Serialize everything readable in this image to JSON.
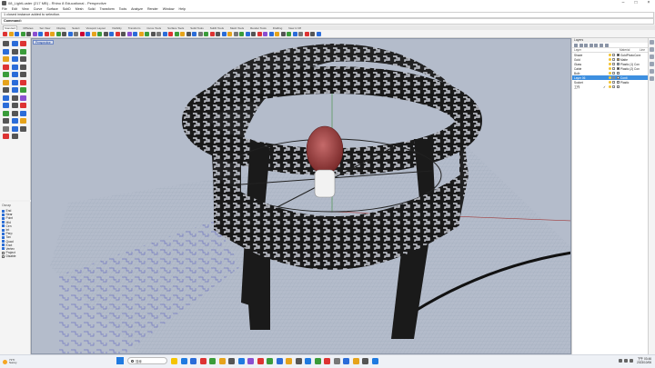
{
  "window": {
    "title": "08_LightLuster (217 MB) - Rhino 8 Educational - Perspective"
  },
  "menu": [
    "File",
    "Edit",
    "View",
    "Curve",
    "Surface",
    "SubD",
    "Mesh",
    "Solid",
    "Transform",
    "Tools",
    "Analyze",
    "Render",
    "Window",
    "Help"
  ],
  "command": {
    "history": "1 closed instance added to selection.",
    "prompt": "Command:"
  },
  "tabs": [
    "Standard",
    "CPlanes",
    "Set View",
    "Display",
    "Select",
    "Viewport Layout",
    "Visibility",
    "Transform",
    "Curve Tools",
    "Surface Tools",
    "Solid Tools",
    "SubD Tools",
    "Mesh Tools",
    "Render Tools",
    "Drafting",
    "New in V8"
  ],
  "toolbar_colors": [
    "#d33",
    "#e6a31b",
    "#2b6cd8",
    "#3a9c3a",
    "#555",
    "#8a4fd0",
    "#2b6cd8",
    "#d33",
    "#e6a31b",
    "#3a9c3a",
    "#555",
    "#2b6cd8",
    "#777",
    "#c03",
    "#2b6cd8",
    "#e6a31b",
    "#3a9c3a",
    "#555",
    "#2b6cd8",
    "#d33",
    "#555",
    "#8a4fd0",
    "#2b6cd8",
    "#e6a31b",
    "#3a9c3a",
    "#555",
    "#777",
    "#2b6cd8",
    "#d33",
    "#3a9c3a",
    "#e6a31b",
    "#555",
    "#2b6cd8",
    "#777",
    "#3a9c3a",
    "#d33",
    "#555",
    "#2b6cd8",
    "#e6a31b",
    "#777",
    "#3a9c3a",
    "#2b6cd8",
    "#555",
    "#d33",
    "#8a4fd0",
    "#2b6cd8",
    "#e6a31b",
    "#555",
    "#3a9c3a",
    "#2b6cd8",
    "#777",
    "#d33",
    "#555",
    "#2b6cd8"
  ],
  "left_tool_colors": [
    "#555",
    "#2b6cd8",
    "#d33",
    "#2b6cd8",
    "#555",
    "#3a9c3a",
    "#e6a31b",
    "#2b6cd8",
    "#555",
    "#d33",
    "#2b6cd8",
    "#555",
    "#3a9c3a",
    "#2b6cd8",
    "#555",
    "#e6a31b",
    "#2b6cd8",
    "#d33",
    "#555",
    "#2b6cd8",
    "#3a9c3a",
    "#2b6cd8",
    "#555",
    "#8a4fd0",
    "#2b6cd8",
    "#555",
    "#d33",
    "#3a9c3a",
    "#555",
    "#2b6cd8",
    "#555",
    "#2b6cd8",
    "#e6a31b",
    "#777",
    "#2b6cd8",
    "#555",
    "#d33",
    "#555"
  ],
  "viewport": {
    "label": "Perspective"
  },
  "osnap": {
    "header": "Osnap",
    "items": [
      {
        "label": "End",
        "on": true
      },
      {
        "label": "Near",
        "on": true
      },
      {
        "label": "Point",
        "on": true
      },
      {
        "label": "Mid",
        "on": true
      },
      {
        "label": "Cen",
        "on": true
      },
      {
        "label": "Int",
        "on": true
      },
      {
        "label": "Perp",
        "on": true
      },
      {
        "label": "Tan",
        "on": true
      },
      {
        "label": "Quad",
        "on": true
      },
      {
        "label": "Knot",
        "on": true
      },
      {
        "label": "Vertex",
        "on": true
      },
      {
        "label": "Project",
        "on": false
      },
      {
        "label": "Disable",
        "on": false
      }
    ]
  },
  "layers_panel": {
    "title": "Layers",
    "headers": {
      "name": "Layer",
      "material": "Material",
      "linetype": "Line"
    },
    "rows": [
      {
        "name": "Shade",
        "current": "",
        "color": "#222222",
        "material": "GoldPhotoCons",
        "selected": false
      },
      {
        "name": "Gold",
        "current": "",
        "color": "#e6a31b",
        "material": "Matte",
        "selected": false
      },
      {
        "name": "Glass",
        "current": "",
        "color": "#7fb6e8",
        "material": "Plastic (1) Con",
        "selected": false
      },
      {
        "name": "Cable",
        "current": "",
        "color": "#222222",
        "material": "Plastic (2) Con",
        "selected": false
      },
      {
        "name": "Bulb",
        "current": "",
        "color": "#ffffff",
        "material": "",
        "selected": false
      },
      {
        "name": "Layer 06",
        "current": "",
        "color": "#ffffff",
        "material": "Conti",
        "selected": true
      },
      {
        "name": "Socket",
        "current": "",
        "color": "#ffffff",
        "material": "Plastic",
        "selected": false
      },
      {
        "name": "工作",
        "current": "✓",
        "color": "#ffffff",
        "material": "",
        "selected": false
      }
    ]
  },
  "taskbar": {
    "weather_temp": "71°F",
    "weather_desc": "Sunny",
    "search_placeholder": "搜尋",
    "app_colors": [
      "#f5c400",
      "#1f7ae0",
      "#2b6cd8",
      "#d33",
      "#3a9c3a",
      "#e6a31b",
      "#555",
      "#1f7ae0",
      "#8a4fd0",
      "#d33",
      "#3a9c3a",
      "#2b6cd8",
      "#e6a31b",
      "#555",
      "#1f7ae0",
      "#3a9c3a",
      "#d33",
      "#777",
      "#2b6cd8",
      "#e6a31b",
      "#555",
      "#1f7ae0"
    ],
    "time": "下午 03:46",
    "date": "2023/10/06"
  }
}
